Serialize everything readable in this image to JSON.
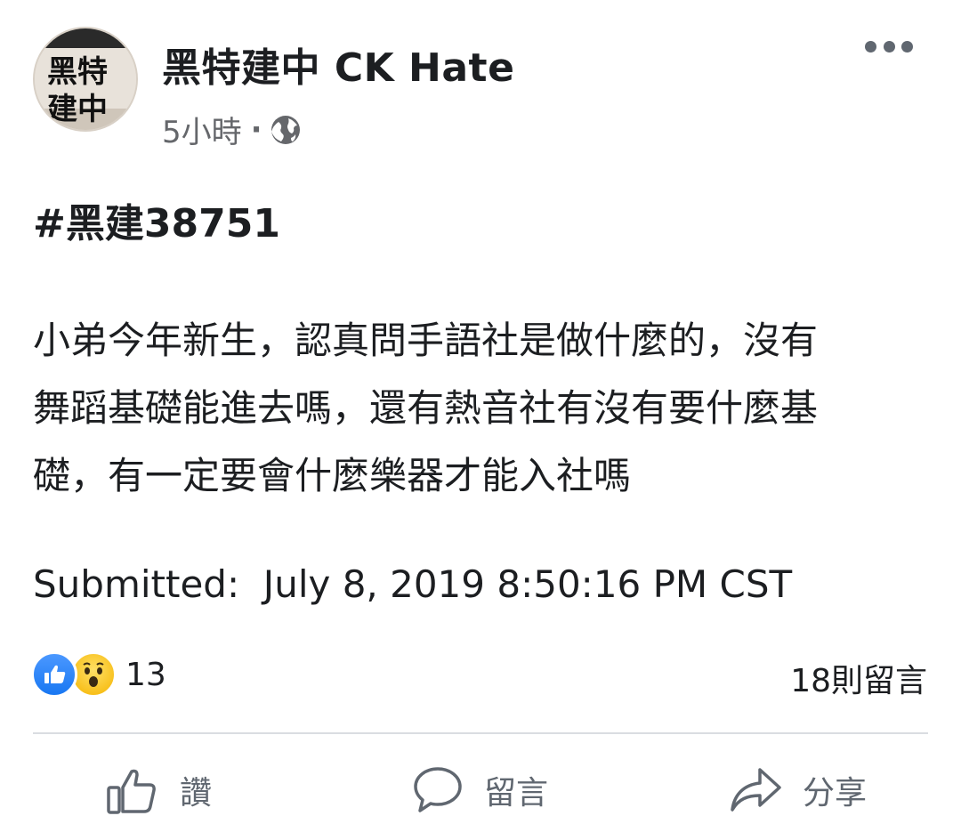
{
  "header": {
    "page_name": "黑特建中 CK Hate",
    "time": "5小時",
    "separator": "·",
    "privacy_icon": "globe-icon",
    "more_icon": "more-options-icon",
    "avatar_text": [
      "黑特",
      "建中"
    ]
  },
  "post": {
    "hashtag": "#黑建38751",
    "lines": [
      "小弟今年新生，認真問手語社是做什麼的，沒有",
      "舞蹈基礎能進去嗎，還有熱音社有沒有要什麼基",
      "礎，有一定要會什麼樂器才能入社嗎"
    ],
    "submitted": "Submitted:  July 8, 2019 8:50:16 PM CST"
  },
  "stats": {
    "reaction_icons": [
      "like-reaction-icon",
      "wow-reaction-icon"
    ],
    "reaction_count": "13",
    "comment_count": "18則留言"
  },
  "actions": {
    "like_label": "讚",
    "comment_label": "留言",
    "share_label": "分享"
  },
  "colors": {
    "text": "#1c1e21",
    "secondary": "#65676b",
    "like_blue": "#1877f2",
    "wow_yellow": "#f5b400",
    "divider": "#dadde1"
  }
}
